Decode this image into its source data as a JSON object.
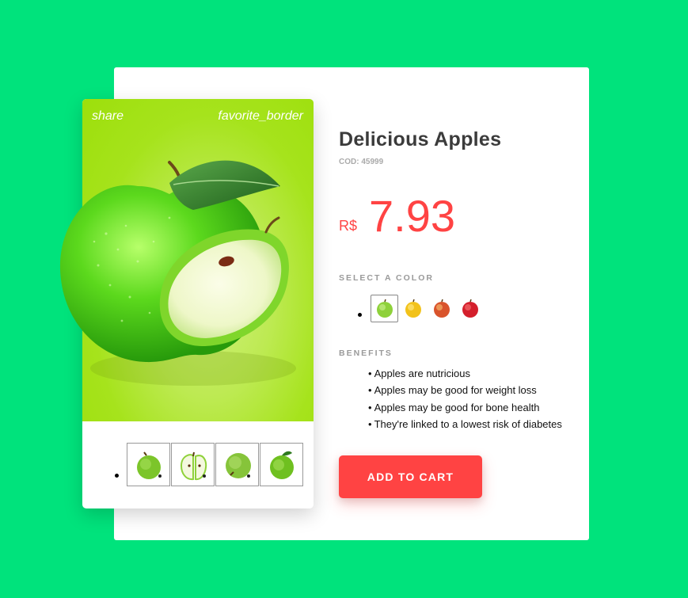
{
  "product": {
    "top_actions": {
      "share": "share",
      "favorite": "favorite_border"
    },
    "title": "Delicious Apples",
    "code": "COD: 45999",
    "currency": "R$",
    "price": "7.93",
    "select_color_label": "SELECT A COLOR",
    "colors": [
      {
        "name": "green-apple",
        "hex": "#8ed13a",
        "selected": true
      },
      {
        "name": "yellow-apple",
        "hex": "#f2c21a",
        "selected": false
      },
      {
        "name": "red-yellow-apple",
        "hex": "#d9542c",
        "selected": false
      },
      {
        "name": "red-apple",
        "hex": "#d41f2c",
        "selected": false
      }
    ],
    "benefits_label": "BENEFITS",
    "benefits": [
      "Apples are nutricious",
      "Apples may be good for weight loss",
      "Apples may be good for bone health",
      "They're linked to a lowest risk of diabetes"
    ],
    "add_to_cart": "ADD TO CART",
    "thumbnails": [
      "green-apple-whole",
      "green-apple-halved",
      "green-apple-top",
      "green-apple-leaf"
    ]
  },
  "colors": {
    "background": "#00e37c",
    "accent": "#ff4343",
    "hero": "#a6e31c"
  }
}
